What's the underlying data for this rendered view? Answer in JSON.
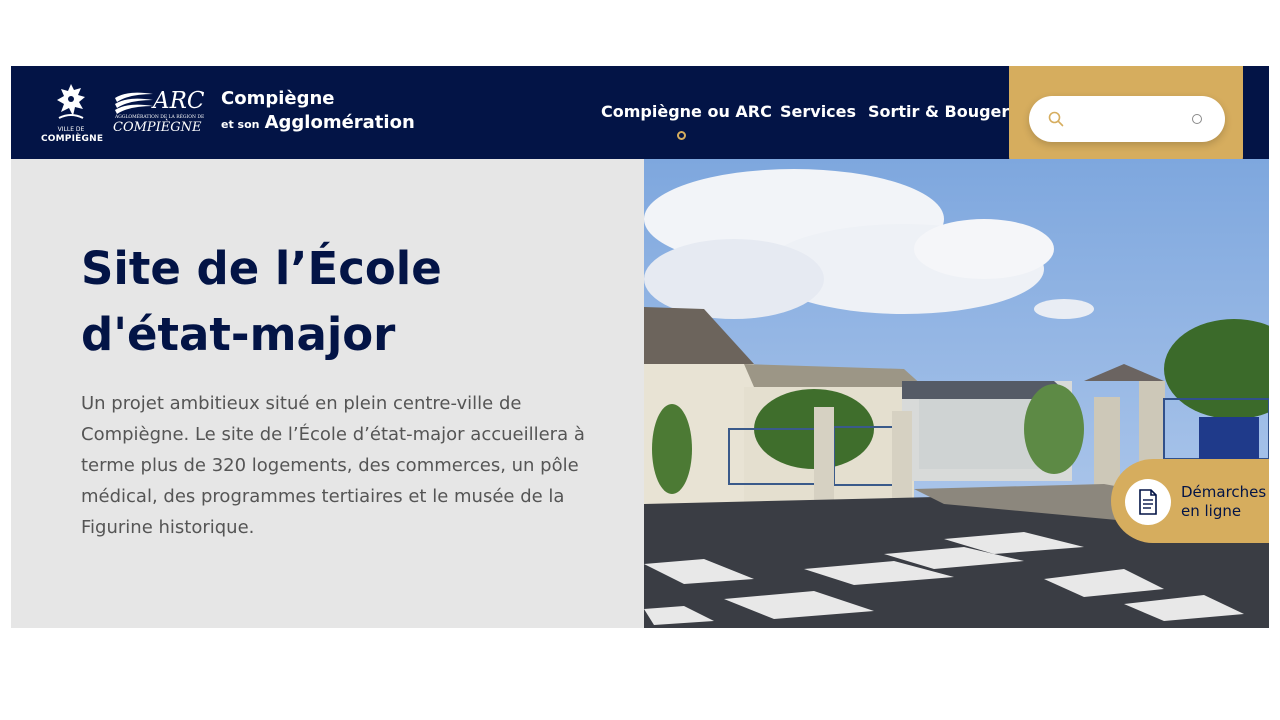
{
  "header": {
    "logo_ville": {
      "line_small": "VILLE DE",
      "line_big": "COMPIÈGNE",
      "icon": "lion-crest-icon"
    },
    "logo_arc": {
      "word": "ARC",
      "tagline": "AGGLOMÉRATION DE LA RÉGION DE",
      "city": "COMPIÈGNE",
      "icon": "arc-waves-icon"
    },
    "brand": {
      "line1": "Compiègne",
      "line2_small": "et son",
      "line2_big": "Agglomération"
    },
    "nav": [
      {
        "label": "Compiègne ou ARC",
        "active": true
      },
      {
        "label": "Services"
      },
      {
        "label": "Sortir & Bouger"
      }
    ],
    "search": {
      "placeholder": "",
      "value": ""
    }
  },
  "hero": {
    "title": "Site de l’École d'état-major",
    "description": "Un projet ambitieux situé en plein centre-ville de Compiègne. Le site de l’École d’état-major accueillera à terme plus de 320 logements, des commerces, un pôle médical, des programmes tertiaires et le musée de la Figurine historique."
  },
  "quick_action": {
    "label": "Démarches en ligne",
    "icon": "document-icon"
  },
  "colors": {
    "navy": "#031446",
    "gold": "#d6ad5e",
    "panel": "#e6e6e6",
    "text": "#555555"
  }
}
